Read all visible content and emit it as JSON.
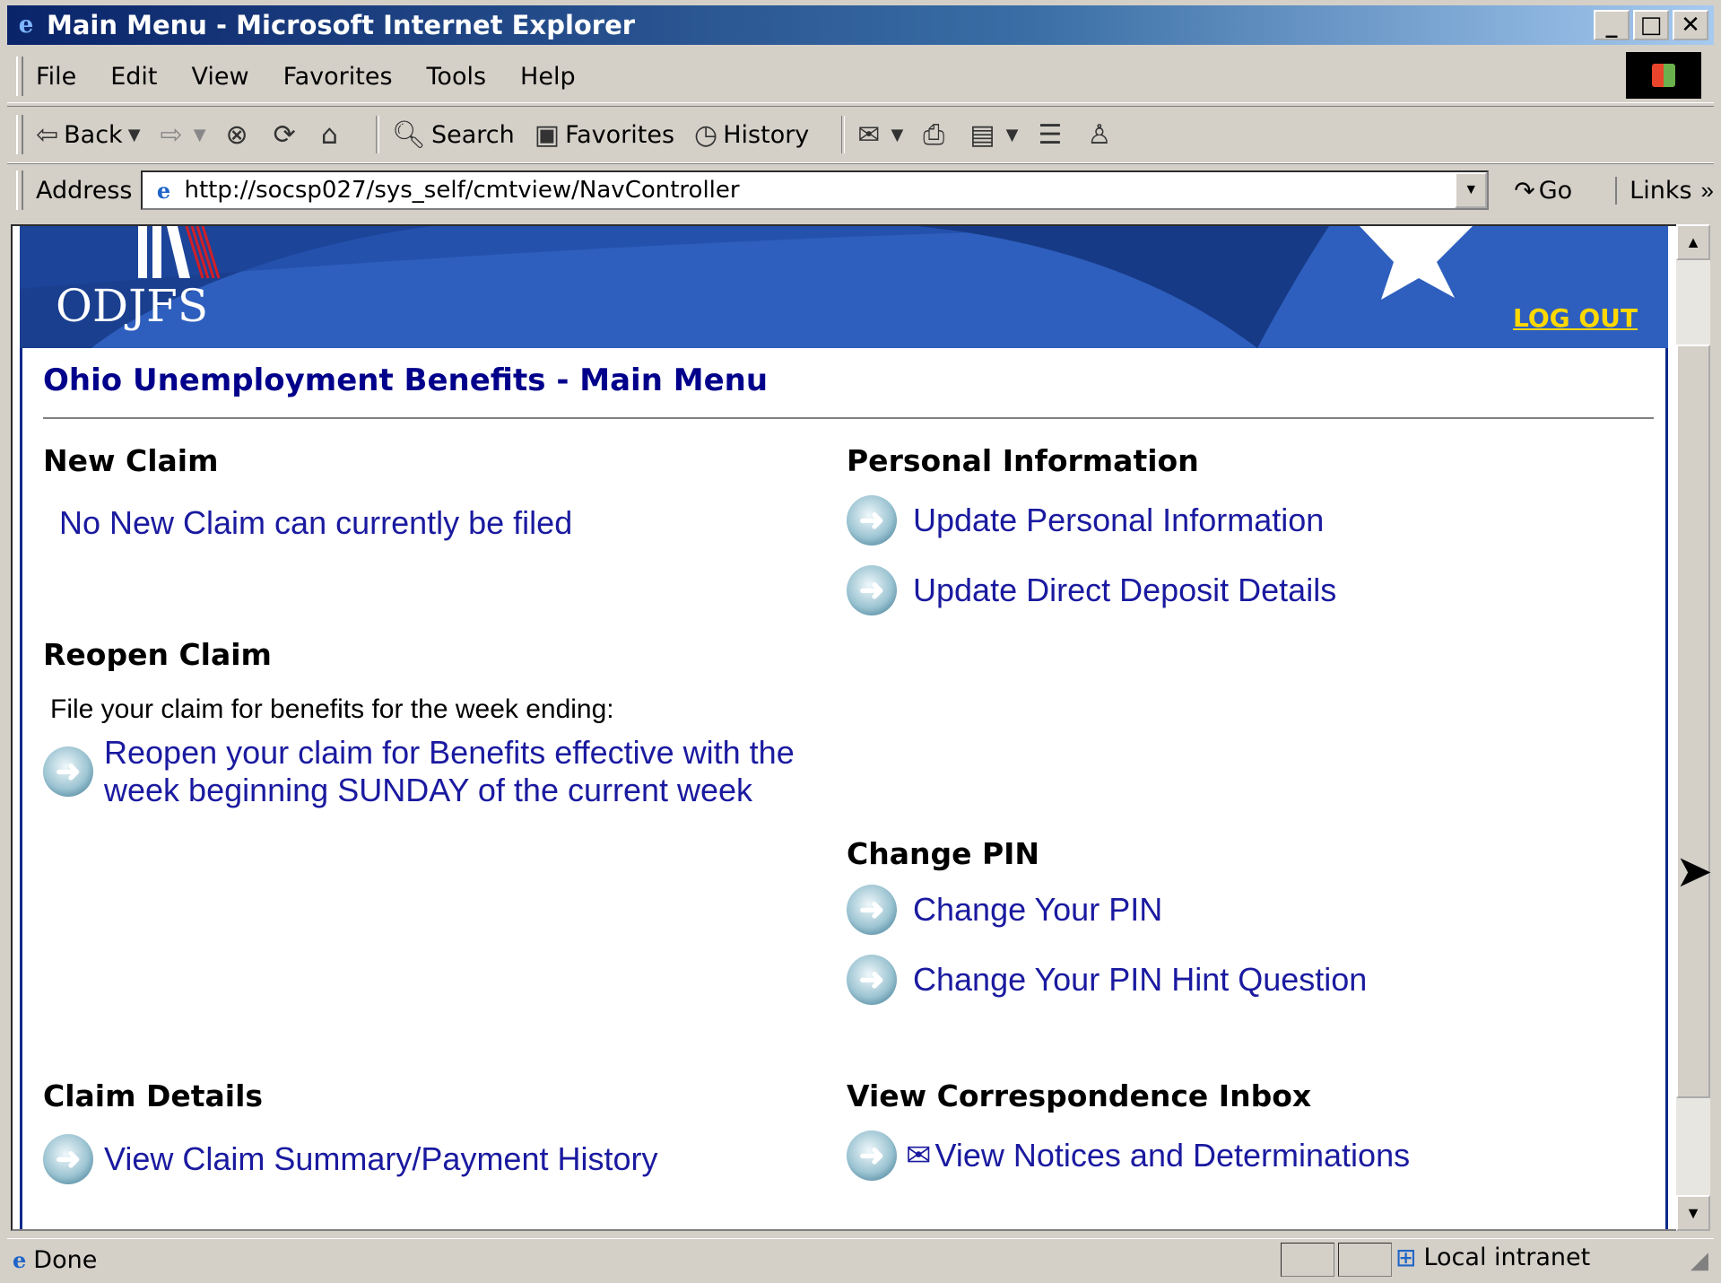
{
  "window": {
    "title": "Main Menu - Microsoft Internet Explorer",
    "controls": [
      "_",
      "□",
      "✕"
    ]
  },
  "menu": [
    "File",
    "Edit",
    "View",
    "Favorites",
    "Tools",
    "Help"
  ],
  "toolbar": {
    "back": "Back",
    "search": "Search",
    "favorites": "Favorites",
    "history": "History"
  },
  "address": {
    "label": "Address",
    "url": "http://socsp027/sys_self/cmtview/NavController",
    "go": "Go",
    "links": "Links"
  },
  "page": {
    "logo": "ODJFS",
    "logout": "LOG OUT",
    "title": "Ohio Unemployment Benefits - Main Menu",
    "new_claim": {
      "heading": "New Claim",
      "text": "No New Claim can currently be filed"
    },
    "reopen_claim": {
      "heading": "Reopen Claim",
      "text": "File your claim for benefits for the week ending:",
      "link_line1": "Reopen your claim for Benefits effective with the",
      "link_line2": "week beginning SUNDAY of the current week"
    },
    "claim_details": {
      "heading": "Claim Details",
      "link": "View Claim Summary/Payment History"
    },
    "personal_info": {
      "heading": "Personal Information",
      "link1": "Update Personal Information",
      "link2": "Update Direct Deposit Details"
    },
    "change_pin": {
      "heading": "Change PIN",
      "link1": "Change Your PIN",
      "link2": "Change Your PIN Hint Question"
    },
    "correspondence": {
      "heading": "View Correspondence Inbox",
      "link": "View Notices and Determinations"
    }
  },
  "status": {
    "text": "Done",
    "zone": "Local intranet"
  },
  "colors": {
    "banner": "#2e5fbe",
    "title_blue": "#00008b",
    "link_blue": "#1a1aa0",
    "logout_yellow": "#ffd800"
  }
}
